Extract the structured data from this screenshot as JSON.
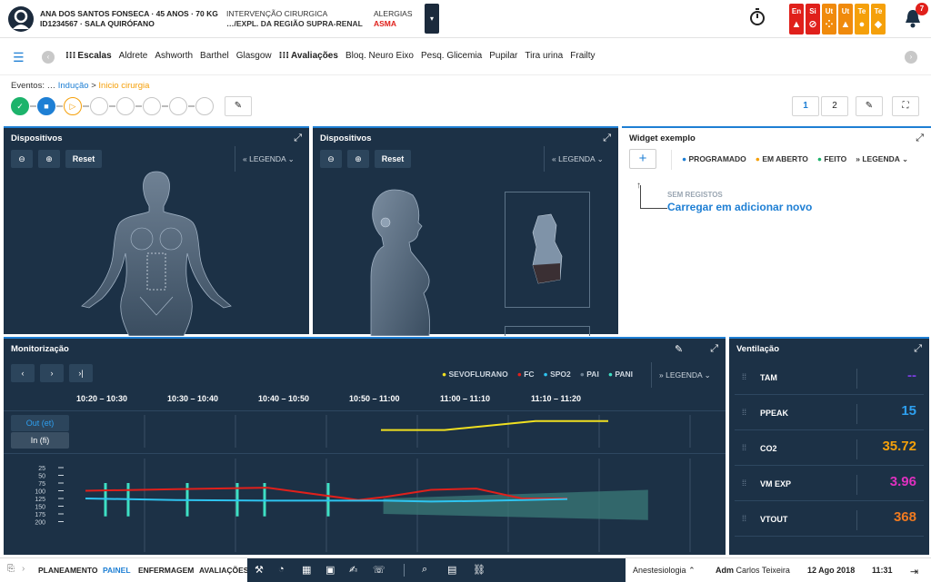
{
  "patient": {
    "line1": "ANA DOS SANTOS FONSECA · 45 ANOS · 70 KG",
    "line2": "ID1234567 · SALA QUIRÓFANO"
  },
  "surgery": {
    "line1": "INTERVENÇÃO CIRURGICA",
    "line2": "…/EXPL. DA REGIÃO SUPRA-RENAL"
  },
  "allergies": {
    "label": "ALERGIAS",
    "value": "ASMA"
  },
  "alerts": [
    {
      "label": "En",
      "color": "#e0201b",
      "icon": "warning-triangle-icon",
      "symbol": "▲"
    },
    {
      "label": "Si",
      "color": "#e0201b",
      "icon": "forbidden-icon",
      "symbol": "⊘"
    },
    {
      "label": "Ut",
      "color": "#f08a0c",
      "icon": "dots-icon",
      "symbol": "⁘"
    },
    {
      "label": "Ut",
      "color": "#f08a0c",
      "icon": "warning-triangle-icon",
      "symbol": "▲"
    },
    {
      "label": "Te",
      "color": "#f5a00a",
      "icon": "circle-icon",
      "symbol": "●"
    },
    {
      "label": "Te",
      "color": "#f5a00a",
      "icon": "diamond-icon",
      "symbol": "◆"
    }
  ],
  "notifications": {
    "count": "7"
  },
  "scales": {
    "escalas_label": "Escalas",
    "escalas_items": [
      "Aldrete",
      "Ashworth",
      "Barthel",
      "Glasgow"
    ],
    "avaliacoes_label": "Avaliações",
    "avaliacoes_items": [
      "Bloq. Neuro Eixo",
      "Pesq. Glicemia",
      "Pupilar",
      "Tira urina",
      "Frailty"
    ]
  },
  "events": {
    "prefix": "Eventos: …",
    "current": "Indução",
    "separator": ">",
    "active": "Inicio cirurgia"
  },
  "view": {
    "page1": "1",
    "page2": "2"
  },
  "devices_front": {
    "title": "Dispositivos",
    "reset": "Reset",
    "legend": "LEGENDA"
  },
  "devices_side": {
    "title": "Dispositivos",
    "reset": "Reset",
    "legend": "LEGENDA"
  },
  "widget": {
    "title": "Widget exemplo",
    "legend_items": [
      {
        "label": "PROGRAMADO",
        "color": "#1e7fd4"
      },
      {
        "label": "EM ABERTO",
        "color": "#f5a00a"
      },
      {
        "label": "FEITO",
        "color": "#1db36b"
      }
    ],
    "legend": "LEGENDA",
    "empty_label": "SEM REGISTOS",
    "empty_action": "Carregar em adicionar novo"
  },
  "monitor": {
    "title": "Monitorização",
    "legend": "LEGENDA",
    "series_legend": [
      {
        "label": "SEVOFLURANO",
        "color": "#f0e020"
      },
      {
        "label": "FC",
        "color": "#e0201b"
      },
      {
        "label": "SPO2",
        "color": "#2ec4f0"
      },
      {
        "label": "PAI",
        "color": "#6b7f92"
      },
      {
        "label": "PANI",
        "color": "#3ee0c4"
      }
    ],
    "time_slots": [
      "10:20 – 10:30",
      "10:30 – 10:40",
      "10:40 – 10:50",
      "10:50 – 11:00",
      "11:00 – 11:10",
      "11:10 – 11:20"
    ],
    "out_label": "Out (et)",
    "in_label": "In (fi)",
    "y_ticks": [
      "200",
      "175",
      "150",
      "125",
      "100",
      "75",
      "50",
      "25"
    ]
  },
  "ventilation": {
    "title": "Ventilação",
    "rows": [
      {
        "label": "TAM",
        "value": "--",
        "color": "#7a3fe0"
      },
      {
        "label": "PPEAK",
        "value": "15",
        "color": "#2ea0f0"
      },
      {
        "label": "CO2",
        "value": "35.72",
        "color": "#f5a00a"
      },
      {
        "label": "VM EXP",
        "value": "3.96",
        "color": "#e030c0"
      },
      {
        "label": "VTOUT",
        "value": "368",
        "color": "#f07a20"
      }
    ]
  },
  "chart_data": {
    "type": "line",
    "x": [
      "10:20 – 10:30",
      "10:30 – 10:40",
      "10:40 – 10:50",
      "10:50 – 11:00",
      "11:00 – 11:10",
      "11:10 – 11:20"
    ],
    "ylim": [
      0,
      200
    ],
    "y_ticks": [
      25,
      50,
      75,
      100,
      125,
      150,
      175,
      200
    ],
    "series": [
      {
        "name": "FC",
        "values": [
          125,
          130,
          135,
          95,
          105,
          128,
          132,
          100,
          100
        ],
        "x_index": [
          0,
          1,
          2,
          3,
          4,
          4.5,
          5,
          5.5,
          6
        ]
      },
      {
        "name": "SPO2",
        "values": [
          100,
          95,
          93,
          93,
          93,
          90,
          92,
          95,
          98
        ],
        "x_index": [
          0,
          1,
          2,
          3,
          4,
          4.5,
          5,
          5.5,
          6
        ]
      },
      {
        "name": "SEVOFLURANO",
        "values": [
          0.55,
          0.55,
          0.9,
          0.9
        ],
        "x_index": [
          3.5,
          4.2,
          5.2,
          6
        ]
      }
    ],
    "pani_bars": [
      0.3,
      0.55,
      1.2,
      1.75,
      2.05,
      2.75
    ]
  },
  "footer": {
    "nav": [
      "PLANEAMENTO",
      "PAINEL",
      "ENFERMAGEM",
      "AVALIAÇÕES"
    ],
    "active_nav": "PAINEL",
    "specialty": "Anestesiologia",
    "user_role": "Adm",
    "user_name": "Carlos Teixeira",
    "date": "12 Ago 2018",
    "time": "11:31"
  }
}
